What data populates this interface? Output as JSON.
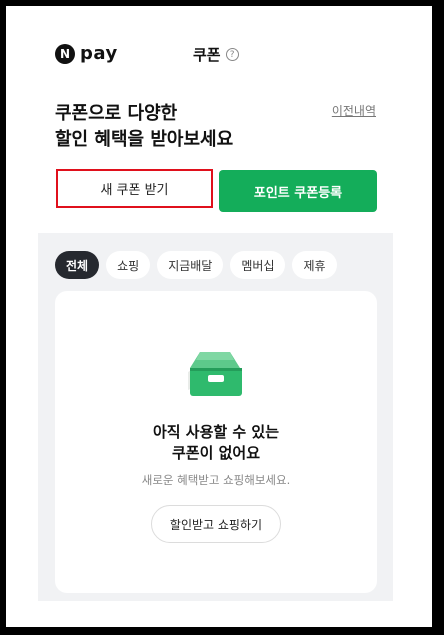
{
  "header": {
    "logo_mark": "N",
    "logo_text": "pay",
    "title": "쿠폰",
    "help_glyph": "?"
  },
  "hero": {
    "line1": "쿠폰으로 다양한",
    "line2": "할인 혜택을 받아보세요",
    "history_link": "이전내역"
  },
  "actions": {
    "new_coupon": "새 쿠폰 받기",
    "point_coupon_register": "포인트 쿠폰등록"
  },
  "filters": {
    "items": [
      "전체",
      "쇼핑",
      "지금배달",
      "멤버십",
      "제휴"
    ],
    "selected": "전체"
  },
  "empty_state": {
    "title_line1": "아직 사용할 수 있는",
    "title_line2": "쿠폰이 없어요",
    "description": "새로운 혜택받고 쇼핑해보세요.",
    "button": "할인받고 쇼핑하기",
    "icon": "empty-box-icon"
  },
  "colors": {
    "brand_green": "#14ad5a",
    "highlight_red": "#e0101c",
    "chip_active": "#26292f",
    "panel_bg": "#f1f2f4"
  }
}
